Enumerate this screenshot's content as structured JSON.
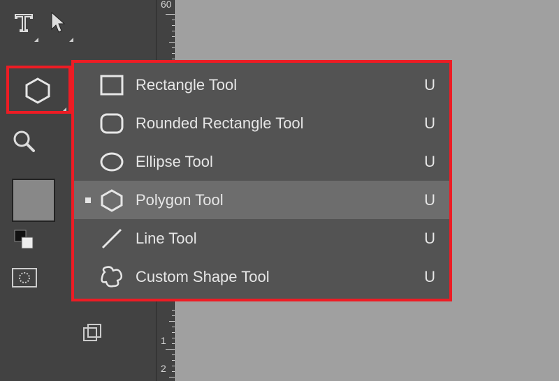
{
  "ruler": {
    "label_top": "60",
    "label_mid1": "1",
    "label_mid2": "2"
  },
  "flyout": {
    "items": [
      {
        "label": "Rectangle Tool",
        "shortcut": "U",
        "icon": "rectangle-icon",
        "selected": false
      },
      {
        "label": "Rounded Rectangle Tool",
        "shortcut": "U",
        "icon": "rounded-rectangle-icon",
        "selected": false
      },
      {
        "label": "Ellipse Tool",
        "shortcut": "U",
        "icon": "ellipse-icon",
        "selected": false
      },
      {
        "label": "Polygon Tool",
        "shortcut": "U",
        "icon": "polygon-icon",
        "selected": true
      },
      {
        "label": "Line Tool",
        "shortcut": "U",
        "icon": "line-icon",
        "selected": false
      },
      {
        "label": "Custom Shape Tool",
        "shortcut": "U",
        "icon": "custom-shape-icon",
        "selected": false
      }
    ]
  }
}
